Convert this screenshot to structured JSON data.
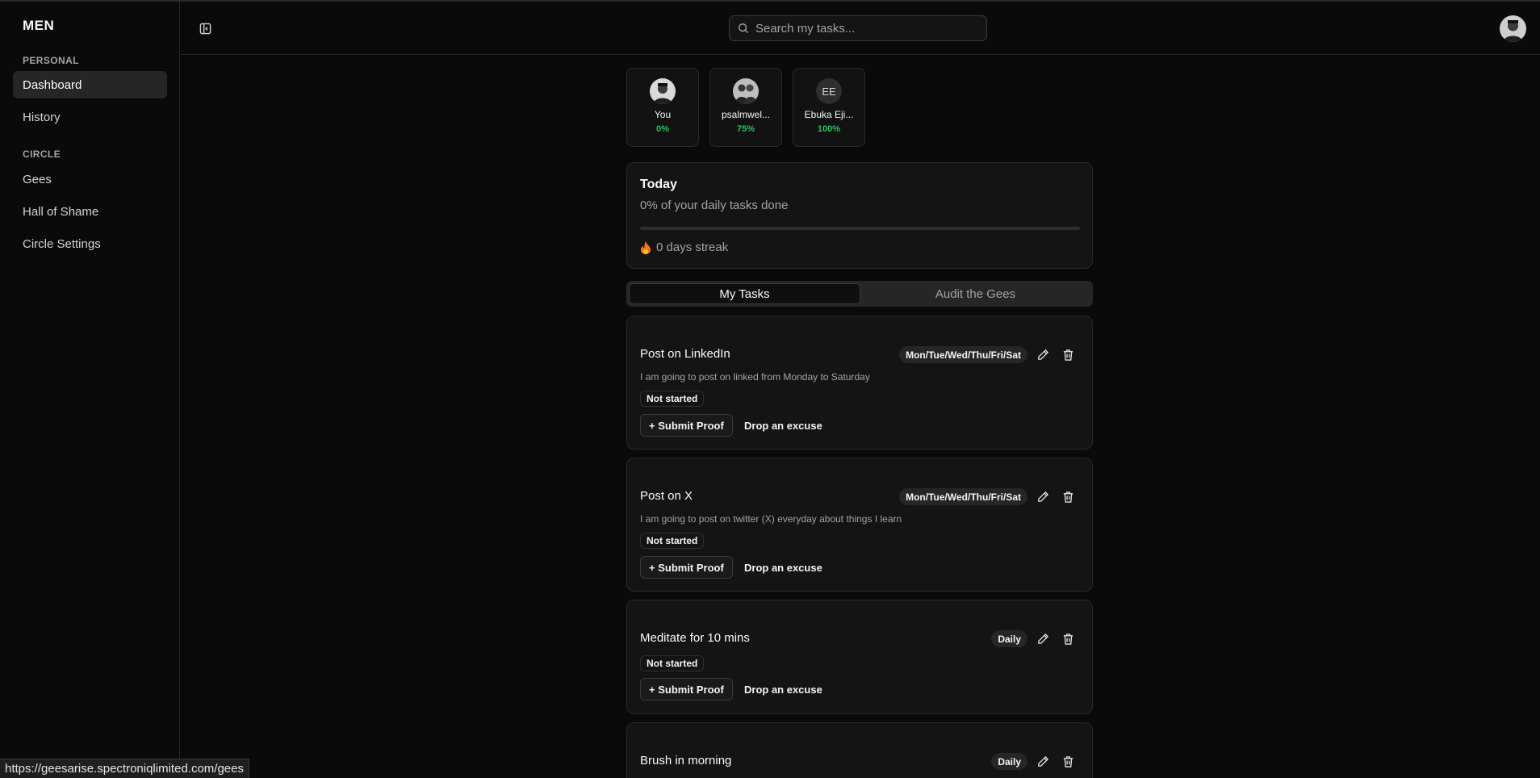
{
  "app": {
    "brand": "MEN"
  },
  "sidebar": {
    "groups": [
      {
        "label": "PERSONAL",
        "items": [
          {
            "label": "Dashboard",
            "active": true
          },
          {
            "label": "History"
          }
        ]
      },
      {
        "label": "CIRCLE",
        "items": [
          {
            "label": "Gees"
          },
          {
            "label": "Hall of Shame"
          },
          {
            "label": "Circle Settings"
          }
        ]
      }
    ]
  },
  "header": {
    "search_placeholder": "Search my tasks..."
  },
  "members": [
    {
      "name": "You",
      "percent": "0%",
      "avatar": "photo"
    },
    {
      "name": "psalmwel...",
      "percent": "75%",
      "avatar": "photo"
    },
    {
      "name": "Ebuka Eji...",
      "percent": "100%",
      "initials": "EE"
    }
  ],
  "today": {
    "title": "Today",
    "subtitle": "0% of your daily tasks done",
    "progress": 0,
    "streak": "0 days streak",
    "streak_icon": "fire-icon"
  },
  "tabs": [
    {
      "label": "My Tasks",
      "active": true
    },
    {
      "label": "Audit the Gees"
    }
  ],
  "tasks": [
    {
      "title": "Post on LinkedIn",
      "schedule": "Mon/Tue/Wed/Thu/Fri/Sat",
      "description": "I am going to post on linked from Monday to Saturday",
      "status": "Not started",
      "proof_label": "+ Submit Proof",
      "excuse_label": "Drop an excuse"
    },
    {
      "title": "Post on X",
      "schedule": "Mon/Tue/Wed/Thu/Fri/Sat",
      "description": "I am going to post on twitter (X) everyday about things I learn",
      "status": "Not started",
      "proof_label": "+ Submit Proof",
      "excuse_label": "Drop an excuse"
    },
    {
      "title": "Meditate for 10 mins",
      "schedule": "Daily",
      "status": "Not started",
      "proof_label": "+ Submit Proof",
      "excuse_label": "Drop an excuse"
    },
    {
      "title": "Brush in morning",
      "schedule": "Daily"
    }
  ],
  "statusbar": {
    "url": "https://geesarise.spectroniqlimited.com/gees"
  },
  "colors": {
    "background": "#0a0a0a",
    "card": "#141414",
    "success": "#22c55e"
  }
}
